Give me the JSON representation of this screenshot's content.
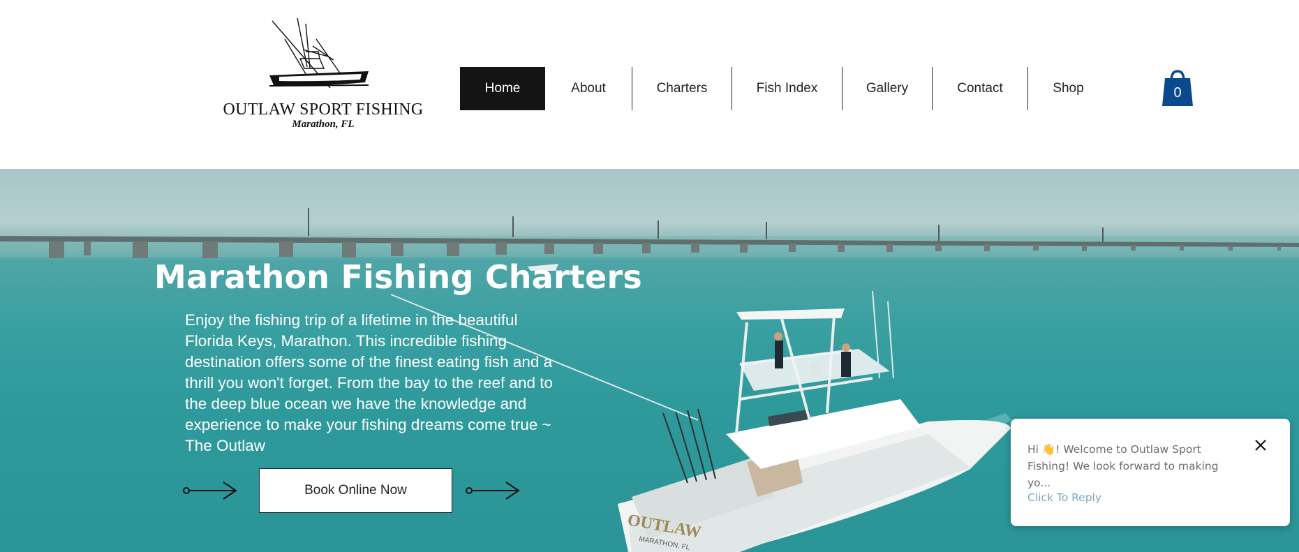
{
  "brand": {
    "name": "OUTLAW SPORT FISHING",
    "location": "Marathon, FL"
  },
  "nav": {
    "items": [
      {
        "label": "Home",
        "active": true
      },
      {
        "label": "About"
      },
      {
        "label": "Charters"
      },
      {
        "label": "Fish Index"
      },
      {
        "label": "Gallery"
      },
      {
        "label": "Contact"
      },
      {
        "label": "Shop"
      }
    ]
  },
  "cart": {
    "count": "0",
    "icon": "shopping-bag-icon",
    "color": "#0a4a8c"
  },
  "hero": {
    "title": "Marathon Fishing Charters",
    "text": "Enjoy the fishing trip of a lifetime in the beautiful Florida Keys, Marathon. This incredible fishing destination offers some of the finest eating fish and a thrill you won't forget. From the bay to the reef and to the deep blue ocean we have the knowledge and experience to make your fishing dreams come true ~ The Outlaw",
    "button_label": "Book Online Now",
    "boat_name": "OUTLAW",
    "boat_port": "MARATHON, FL"
  },
  "chat": {
    "message": "Hi 👋! Welcome to Outlaw Sport Fishing! We look forward to making yo...",
    "reply_label": "Click To Reply"
  },
  "colors": {
    "nav_active_bg": "#141414",
    "water": "#2f9a9c",
    "chat_link": "#7fa5bf"
  }
}
